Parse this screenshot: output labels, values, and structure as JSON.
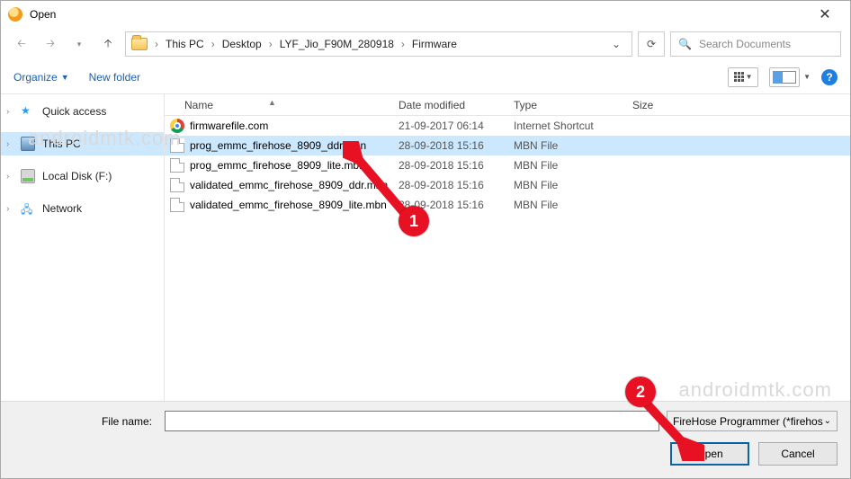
{
  "window": {
    "title": "Open"
  },
  "breadcrumbs": {
    "root_sep": "›",
    "items": [
      "This PC",
      "Desktop",
      "LYF_Jio_F90M_280918",
      "Firmware"
    ]
  },
  "search": {
    "placeholder": "Search Documents"
  },
  "toolbar": {
    "organize": "Organize",
    "new_folder": "New folder"
  },
  "sidebar": {
    "items": [
      {
        "label": "Quick access"
      },
      {
        "label": "This PC"
      },
      {
        "label": "Local Disk (F:)"
      },
      {
        "label": "Network"
      }
    ]
  },
  "columns": {
    "name": "Name",
    "date": "Date modified",
    "type": "Type",
    "size": "Size"
  },
  "files": [
    {
      "name": "firmwarefile.com",
      "date": "21-09-2017 06:14",
      "type": "Internet Shortcut"
    },
    {
      "name": "prog_emmc_firehose_8909_ddr.mbn",
      "date": "28-09-2018 15:16",
      "type": "MBN File"
    },
    {
      "name": "prog_emmc_firehose_8909_lite.mbn",
      "date": "28-09-2018 15:16",
      "type": "MBN File"
    },
    {
      "name": "validated_emmc_firehose_8909_ddr.mbn",
      "date": "28-09-2018 15:16",
      "type": "MBN File"
    },
    {
      "name": "validated_emmc_firehose_8909_lite.mbn",
      "date": "28-09-2018 15:16",
      "type": "MBN File"
    }
  ],
  "bottom": {
    "filename_label": "File name:",
    "filename_value": "",
    "filter": "FireHose Programmer (*firehos",
    "open": "Open",
    "cancel": "Cancel"
  },
  "annotations": {
    "badge1": "1",
    "badge2": "2"
  },
  "watermark": "androidmtk.com"
}
